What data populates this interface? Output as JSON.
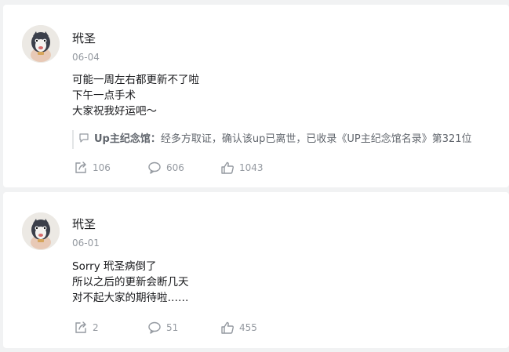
{
  "posts": [
    {
      "username": "玳圣",
      "date": "06-04",
      "lines": [
        "可能一周左右都更新不了啦",
        "下午一点手术",
        "大家祝我好运吧～"
      ],
      "quote": {
        "author": "Up主纪念馆：",
        "text": "经多方取证，确认该up已离世，已收录《UP主纪念馆名录》第321位"
      },
      "shares": "106",
      "comments": "606",
      "likes": "1043"
    },
    {
      "username": "玳圣",
      "date": "06-01",
      "lines": [
        "Sorry 玳圣病倒了",
        "所以之后的更新会断几天",
        "对不起大家的期待啦……"
      ],
      "shares": "2",
      "comments": "51",
      "likes": "455"
    }
  ],
  "icons": [
    "avatar",
    "quote-icon",
    "share-icon",
    "comment-icon",
    "like-icon"
  ],
  "colors": {
    "muted": "#9499a0",
    "text": "#18191c",
    "background": "#f1f2f3"
  }
}
